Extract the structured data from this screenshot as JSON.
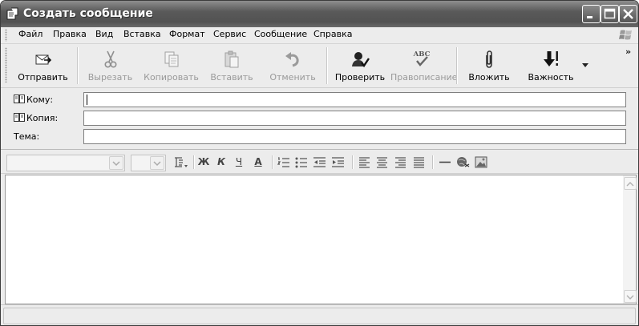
{
  "window": {
    "title": "Создать сообщение",
    "controls": [
      "minimize",
      "maximize",
      "close"
    ]
  },
  "menu": [
    "Файл",
    "Правка",
    "Вид",
    "Вставка",
    "Формат",
    "Сервис",
    "Сообщение",
    "Справка"
  ],
  "toolbar": {
    "send": "Отправить",
    "cut": "Вырезать",
    "copy": "Копировать",
    "paste": "Вставить",
    "undo": "Отменить",
    "check": "Проверить",
    "spelling": "Правописание",
    "spelling_icon_text": "ABC",
    "attach": "Вложить",
    "priority": "Важность",
    "more": "»"
  },
  "fields": {
    "to_label": "Кому:",
    "cc_label": "Копия:",
    "subject_label": "Тема:",
    "to_value": "",
    "cc_value": "",
    "subject_value": ""
  },
  "format": {
    "font_value": "",
    "size_value": "",
    "bold": "Ж",
    "italic": "К",
    "underline": "Ч",
    "font_color": "А"
  },
  "body": {
    "text": ""
  },
  "icons": [
    "app-icon",
    "minimize-icon",
    "maximize-icon",
    "close-icon",
    "windows-logo-icon",
    "send-icon",
    "cut-icon",
    "copy-icon",
    "paste-icon",
    "undo-icon",
    "check-names-icon",
    "spelling-icon",
    "attach-icon",
    "priority-icon",
    "dropdown-arrow-icon",
    "address-book-icon",
    "paragraph-style-icon",
    "numbered-list-icon",
    "bullet-list-icon",
    "decrease-indent-icon",
    "increase-indent-icon",
    "align-left-icon",
    "align-center-icon",
    "align-right-icon",
    "justify-icon",
    "horizontal-line-icon",
    "hyperlink-icon",
    "insert-picture-icon"
  ],
  "colors": {
    "titlebar": "#5a5a5a",
    "chrome": "#ececec",
    "disabled_text": "#9a9a9a"
  }
}
